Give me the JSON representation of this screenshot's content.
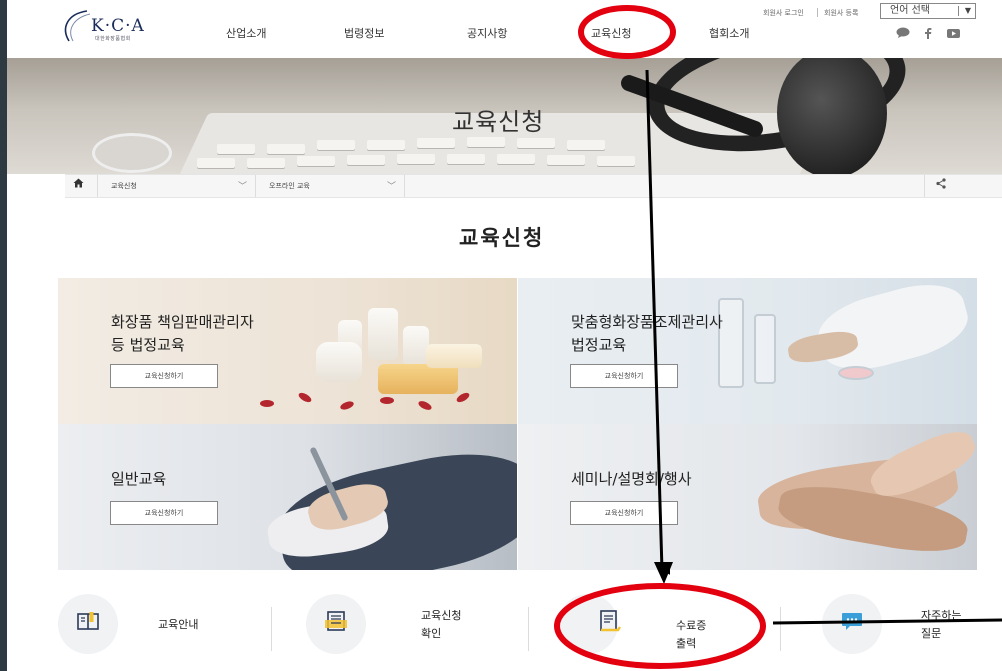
{
  "header": {
    "logo_text": "K·C·A",
    "logo_subtext": "대한화장품협회",
    "nav": [
      {
        "label": "산업소개"
      },
      {
        "label": "법령정보"
      },
      {
        "label": "공지사항"
      },
      {
        "label": "교육신청"
      },
      {
        "label": "협회소개"
      }
    ],
    "util_links": [
      "회원사 로그인",
      "회원사 등록"
    ],
    "language_select": "언어 선택",
    "social_icons": [
      "talk-icon",
      "facebook-icon",
      "youtube-icon"
    ]
  },
  "hero": {
    "title": "교육신청"
  },
  "breadcrumb": {
    "level1": "교육신청",
    "level2": "오프라인 교육"
  },
  "page_title": "교육신청",
  "cards": [
    {
      "title": "화장품 책임판매관리자\n등 법정교육",
      "button": "교육신청하기"
    },
    {
      "title": "맞춤형화장품조제관리사\n법정교육",
      "button": "교육신청하기"
    },
    {
      "title": "일반교육",
      "button": "교육신청하기"
    },
    {
      "title": "세미나/설명회/행사",
      "button": "교육신청하기"
    }
  ],
  "quick_menu": [
    {
      "label": "교육안내",
      "icon": "book-icon"
    },
    {
      "label": "교육신청\n확인",
      "icon": "document-icon"
    },
    {
      "label": "수료증\n출력",
      "icon": "certificate-icon"
    },
    {
      "label": "자주하는\n질문",
      "icon": "chat-icon"
    }
  ],
  "colors": {
    "annotation": "#e3000f",
    "arrow": "#000000",
    "logo_navy": "#1a2c5a"
  }
}
